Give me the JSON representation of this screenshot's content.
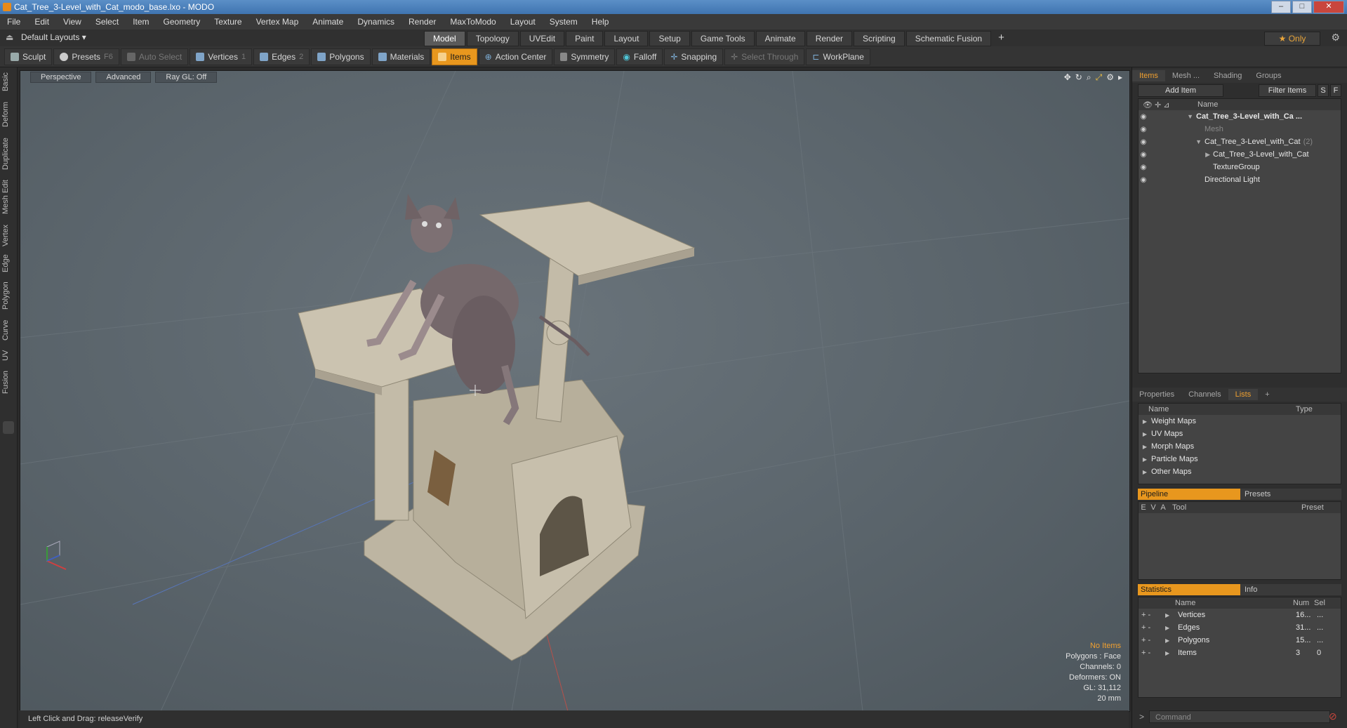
{
  "window": {
    "title": "Cat_Tree_3-Level_with_Cat_modo_base.lxo - MODO"
  },
  "menu": [
    "File",
    "Edit",
    "View",
    "Select",
    "Item",
    "Geometry",
    "Texture",
    "Vertex Map",
    "Animate",
    "Dynamics",
    "Render",
    "MaxToModo",
    "Layout",
    "System",
    "Help"
  ],
  "layoutbar": {
    "layouts_label": "Default Layouts ▾",
    "tabs": [
      "Model",
      "Topology",
      "UVEdit",
      "Paint",
      "Layout",
      "Setup",
      "Game Tools",
      "Animate",
      "Render",
      "Scripting",
      "Schematic Fusion"
    ],
    "active_tab": "Model",
    "only_label": "★  Only"
  },
  "toolbar": {
    "sculpt": "Sculpt",
    "presets": "Presets",
    "presets_key": "F6",
    "auto_select": "Auto Select",
    "vertices": "Vertices",
    "vertices_key": "1",
    "edges": "Edges",
    "edges_key": "2",
    "polygons": "Polygons",
    "materials": "Materials",
    "items": "Items",
    "action_center": "Action Center",
    "symmetry": "Symmetry",
    "falloff": "Falloff",
    "snapping": "Snapping",
    "select_through": "Select Through",
    "workplane": "WorkPlane"
  },
  "left_tabs": [
    "Basic",
    "Deform",
    "Duplicate",
    "Mesh Edit",
    "Vertex",
    "Edge",
    "Polygon",
    "Curve",
    "UV",
    "Fusion"
  ],
  "viewport": {
    "view": "Perspective",
    "mode": "Advanced",
    "raygl": "Ray GL: Off",
    "stats": {
      "no_items": "No Items",
      "polygons": "Polygons : Face",
      "channels": "Channels: 0",
      "deformers": "Deformers: ON",
      "gl": "GL: 31,112",
      "scale": "20 mm"
    }
  },
  "statusbar": {
    "text": "Left Click and Drag:   releaseVerify"
  },
  "items_panel": {
    "tabs": [
      "Items",
      "Mesh ...",
      "Shading",
      "Groups"
    ],
    "add_item": "Add Item",
    "filter_items": "Filter Items",
    "btn_s": "S",
    "btn_f": "F",
    "col_name": "Name",
    "tree": [
      {
        "label": "Cat_Tree_3-Level_with_Ca ...",
        "indent": 0,
        "bold": true,
        "arrow": "▼"
      },
      {
        "label": "Mesh",
        "indent": 1,
        "dim": true,
        "arrow": ""
      },
      {
        "label": "Cat_Tree_3-Level_with_Cat",
        "suffix": "(2)",
        "indent": 1,
        "arrow": "▼"
      },
      {
        "label": "Cat_Tree_3-Level_with_Cat",
        "indent": 2,
        "arrow": "▶"
      },
      {
        "label": "TextureGroup",
        "indent": 2,
        "arrow": ""
      },
      {
        "label": "Directional Light",
        "indent": 1,
        "arrow": ""
      }
    ]
  },
  "lists_panel": {
    "tabs": [
      "Properties",
      "Channels",
      "Lists",
      "+"
    ],
    "col_name": "Name",
    "col_type": "Type",
    "rows": [
      "Weight Maps",
      "UV Maps",
      "Morph Maps",
      "Particle Maps",
      "Other Maps"
    ]
  },
  "pipeline_panel": {
    "tab_pipeline": "Pipeline",
    "tab_presets": "Presets",
    "cols": [
      "E",
      "V",
      "A",
      "Tool",
      "Preset"
    ]
  },
  "stats_panel": {
    "tab_statistics": "Statistics",
    "tab_info": "Info",
    "col_name": "Name",
    "col_num": "Num",
    "col_sel": "Sel",
    "rows": [
      {
        "name": "Vertices",
        "num": "16...",
        "sel": "..."
      },
      {
        "name": "Edges",
        "num": "31...",
        "sel": "..."
      },
      {
        "name": "Polygons",
        "num": "15...",
        "sel": "..."
      },
      {
        "name": "Items",
        "num": "3",
        "sel": "0"
      }
    ]
  },
  "command": {
    "placeholder": "Command"
  }
}
